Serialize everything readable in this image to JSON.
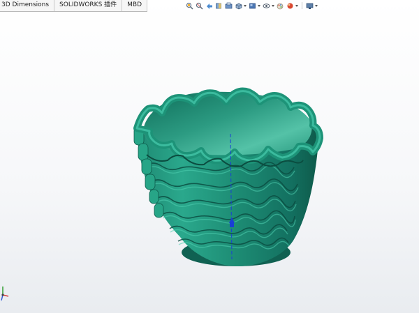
{
  "tabs": [
    {
      "label": "3D Dimensions"
    },
    {
      "label": "SOLIDWORKS 插件"
    },
    {
      "label": "MBD"
    }
  ],
  "toolbar_icons": [
    "zoom-to-fit-icon",
    "zoom-to-area-icon",
    "previous-view-icon",
    "section-view-icon",
    "dynamic-annotation-view-icon",
    "view-orientation-icon",
    "display-style-icon",
    "hide-show-items-icon",
    "edit-appearance-icon",
    "apply-scene-icon",
    "view-settings-icon"
  ],
  "model": {
    "name": "wavy-pot",
    "color": "#1f9a80"
  },
  "colors": {
    "tab_bg": "#f6f6f6",
    "viewport_top": "#ffffff",
    "viewport_bottom": "#e9ecf0",
    "model_base": "#1f9a80",
    "model_dark": "#0e5a4a",
    "model_light": "#3fc2a6",
    "axis_blue": "#1a3fd6"
  }
}
